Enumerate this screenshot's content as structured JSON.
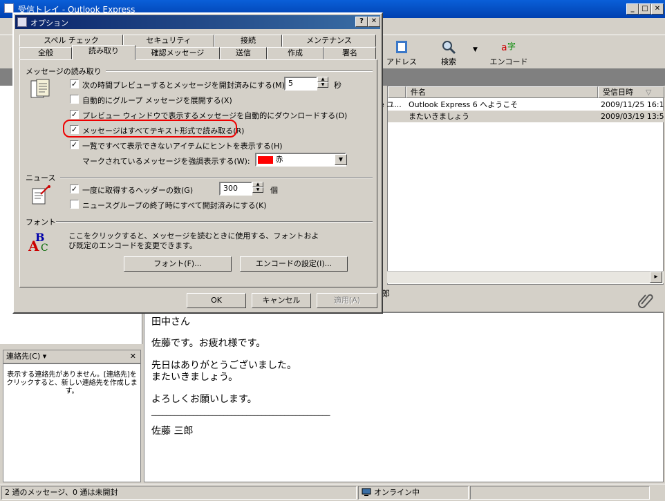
{
  "main_window": {
    "title": "受信トレイ - Outlook Express",
    "toolbar": [
      {
        "label": "アドレス",
        "icon": "address-book-icon"
      },
      {
        "label": "検索",
        "icon": "search-icon"
      },
      {
        "label": "エンコード",
        "icon": "encoding-icon"
      }
    ],
    "message_list": {
      "columns": [
        "件名",
        "受信日時"
      ],
      "sort_indicator": "▽",
      "rows": [
        {
          "from": "e ユ...",
          "subject": "Outlook Express 6 へようこそ",
          "date": "2009/11/25 16:19"
        },
        {
          "from": "",
          "subject": "またいきましょう",
          "date": "2009/03/19 13:50"
        }
      ]
    },
    "preview": {
      "header_fragment": "郎",
      "body_lines": [
        "田中さん",
        "佐藤です。お疲れ様です。",
        "先日はありがとうございました。",
        "またいきましょう。",
        "よろしくお願いします。",
        "_______________________________________________",
        "佐藤 三郎"
      ]
    },
    "contacts": {
      "label": "連絡先(C) ▾",
      "close": "✕",
      "empty_text": "表示する連絡先がありません。[連絡先]をクリックすると、新しい連絡先を作成します。"
    },
    "status": {
      "messages": "2 通のメッセージ、0 通は未開封",
      "online": "オンライン中"
    }
  },
  "dialog": {
    "title": "オプション",
    "title_buttons": [
      "?",
      "✕"
    ],
    "tabs_back": [
      "スペル チェック",
      "セキュリティ",
      "接続",
      "メンテナンス"
    ],
    "tabs_front": [
      "全般",
      "読み取り",
      "確認メッセージ",
      "送信",
      "作成",
      "署名"
    ],
    "active_tab": "読み取り",
    "reading": {
      "group_label": "メッセージの読み取り",
      "options": [
        {
          "label": "次の時間プレビューするとメッセージを開封済みにする(M)",
          "checked": true
        },
        {
          "label": "自動的にグループ メッセージを展開する(X)",
          "checked": false
        },
        {
          "label": "プレビュー ウィンドウで表示するメッセージを自動的にダウンロードする(D)",
          "checked": true
        },
        {
          "label": "メッセージはすべてテキスト形式で読み取る(R)",
          "checked": true
        },
        {
          "label": "一覧ですべて表示できないアイテムにヒントを表示する(H)",
          "checked": true
        }
      ],
      "preview_seconds": "5",
      "seconds_unit": "秒",
      "highlight_label": "マークされているメッセージを強調表示する(W):",
      "highlight_color_name": "赤",
      "highlight_color": "#ff0000"
    },
    "news": {
      "group_label": "ニュース",
      "options": [
        {
          "label": "一度に取得するヘッダーの数(G)",
          "checked": true
        },
        {
          "label": "ニュースグループの終了時にすべて開封済みにする(K)",
          "checked": false
        }
      ],
      "header_count": "300",
      "count_unit": "個"
    },
    "font": {
      "group_label": "フォント",
      "description_line1": "ここをクリックすると、メッセージを読むときに使用する、フォントおよ",
      "description_line2": "び既定のエンコードを変更できます。",
      "font_button": "フォント(F)...",
      "encoding_button": "エンコードの設定(I)..."
    },
    "buttons": {
      "ok": "OK",
      "cancel": "キャンセル",
      "apply": "適用(A)"
    },
    "accent_highlight": "#e00000"
  }
}
